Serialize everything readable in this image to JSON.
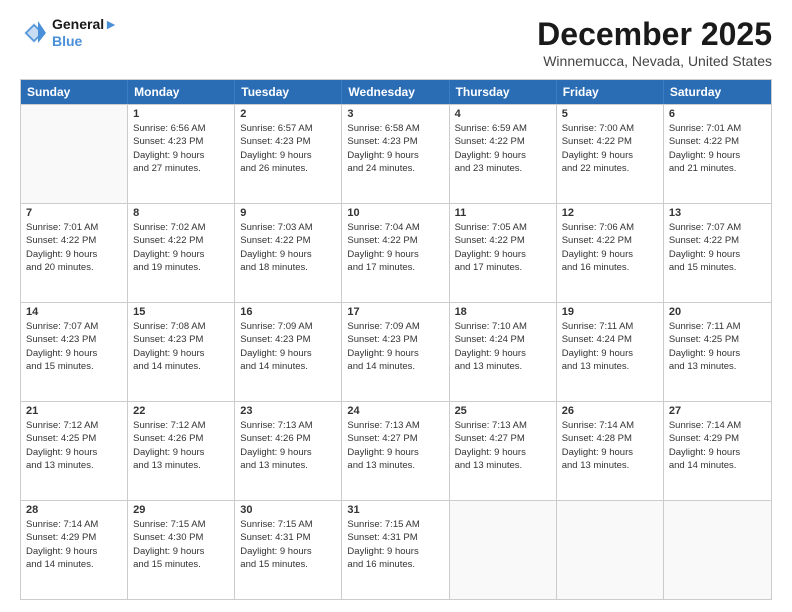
{
  "logo": {
    "line1": "General",
    "line2": "Blue"
  },
  "title": "December 2025",
  "location": "Winnemucca, Nevada, United States",
  "days_of_week": [
    "Sunday",
    "Monday",
    "Tuesday",
    "Wednesday",
    "Thursday",
    "Friday",
    "Saturday"
  ],
  "weeks": [
    [
      {
        "day": "",
        "empty": true
      },
      {
        "day": "1",
        "sunrise": "6:56 AM",
        "sunset": "4:23 PM",
        "daylight": "9 hours and 27 minutes."
      },
      {
        "day": "2",
        "sunrise": "6:57 AM",
        "sunset": "4:23 PM",
        "daylight": "9 hours and 26 minutes."
      },
      {
        "day": "3",
        "sunrise": "6:58 AM",
        "sunset": "4:23 PM",
        "daylight": "9 hours and 24 minutes."
      },
      {
        "day": "4",
        "sunrise": "6:59 AM",
        "sunset": "4:22 PM",
        "daylight": "9 hours and 23 minutes."
      },
      {
        "day": "5",
        "sunrise": "7:00 AM",
        "sunset": "4:22 PM",
        "daylight": "9 hours and 22 minutes."
      },
      {
        "day": "6",
        "sunrise": "7:01 AM",
        "sunset": "4:22 PM",
        "daylight": "9 hours and 21 minutes."
      }
    ],
    [
      {
        "day": "7",
        "sunrise": "7:01 AM",
        "sunset": "4:22 PM",
        "daylight": "9 hours and 20 minutes."
      },
      {
        "day": "8",
        "sunrise": "7:02 AM",
        "sunset": "4:22 PM",
        "daylight": "9 hours and 19 minutes."
      },
      {
        "day": "9",
        "sunrise": "7:03 AM",
        "sunset": "4:22 PM",
        "daylight": "9 hours and 18 minutes."
      },
      {
        "day": "10",
        "sunrise": "7:04 AM",
        "sunset": "4:22 PM",
        "daylight": "9 hours and 17 minutes."
      },
      {
        "day": "11",
        "sunrise": "7:05 AM",
        "sunset": "4:22 PM",
        "daylight": "9 hours and 17 minutes."
      },
      {
        "day": "12",
        "sunrise": "7:06 AM",
        "sunset": "4:22 PM",
        "daylight": "9 hours and 16 minutes."
      },
      {
        "day": "13",
        "sunrise": "7:07 AM",
        "sunset": "4:22 PM",
        "daylight": "9 hours and 15 minutes."
      }
    ],
    [
      {
        "day": "14",
        "sunrise": "7:07 AM",
        "sunset": "4:23 PM",
        "daylight": "9 hours and 15 minutes."
      },
      {
        "day": "15",
        "sunrise": "7:08 AM",
        "sunset": "4:23 PM",
        "daylight": "9 hours and 14 minutes."
      },
      {
        "day": "16",
        "sunrise": "7:09 AM",
        "sunset": "4:23 PM",
        "daylight": "9 hours and 14 minutes."
      },
      {
        "day": "17",
        "sunrise": "7:09 AM",
        "sunset": "4:23 PM",
        "daylight": "9 hours and 14 minutes."
      },
      {
        "day": "18",
        "sunrise": "7:10 AM",
        "sunset": "4:24 PM",
        "daylight": "9 hours and 13 minutes."
      },
      {
        "day": "19",
        "sunrise": "7:11 AM",
        "sunset": "4:24 PM",
        "daylight": "9 hours and 13 minutes."
      },
      {
        "day": "20",
        "sunrise": "7:11 AM",
        "sunset": "4:25 PM",
        "daylight": "9 hours and 13 minutes."
      }
    ],
    [
      {
        "day": "21",
        "sunrise": "7:12 AM",
        "sunset": "4:25 PM",
        "daylight": "9 hours and 13 minutes."
      },
      {
        "day": "22",
        "sunrise": "7:12 AM",
        "sunset": "4:26 PM",
        "daylight": "9 hours and 13 minutes."
      },
      {
        "day": "23",
        "sunrise": "7:13 AM",
        "sunset": "4:26 PM",
        "daylight": "9 hours and 13 minutes."
      },
      {
        "day": "24",
        "sunrise": "7:13 AM",
        "sunset": "4:27 PM",
        "daylight": "9 hours and 13 minutes."
      },
      {
        "day": "25",
        "sunrise": "7:13 AM",
        "sunset": "4:27 PM",
        "daylight": "9 hours and 13 minutes."
      },
      {
        "day": "26",
        "sunrise": "7:14 AM",
        "sunset": "4:28 PM",
        "daylight": "9 hours and 13 minutes."
      },
      {
        "day": "27",
        "sunrise": "7:14 AM",
        "sunset": "4:29 PM",
        "daylight": "9 hours and 14 minutes."
      }
    ],
    [
      {
        "day": "28",
        "sunrise": "7:14 AM",
        "sunset": "4:29 PM",
        "daylight": "9 hours and 14 minutes."
      },
      {
        "day": "29",
        "sunrise": "7:15 AM",
        "sunset": "4:30 PM",
        "daylight": "9 hours and 15 minutes."
      },
      {
        "day": "30",
        "sunrise": "7:15 AM",
        "sunset": "4:31 PM",
        "daylight": "9 hours and 15 minutes."
      },
      {
        "day": "31",
        "sunrise": "7:15 AM",
        "sunset": "4:31 PM",
        "daylight": "9 hours and 16 minutes."
      },
      {
        "day": "",
        "empty": true
      },
      {
        "day": "",
        "empty": true
      },
      {
        "day": "",
        "empty": true
      }
    ]
  ],
  "labels": {
    "sunrise": "Sunrise:",
    "sunset": "Sunset:",
    "daylight": "Daylight:"
  }
}
